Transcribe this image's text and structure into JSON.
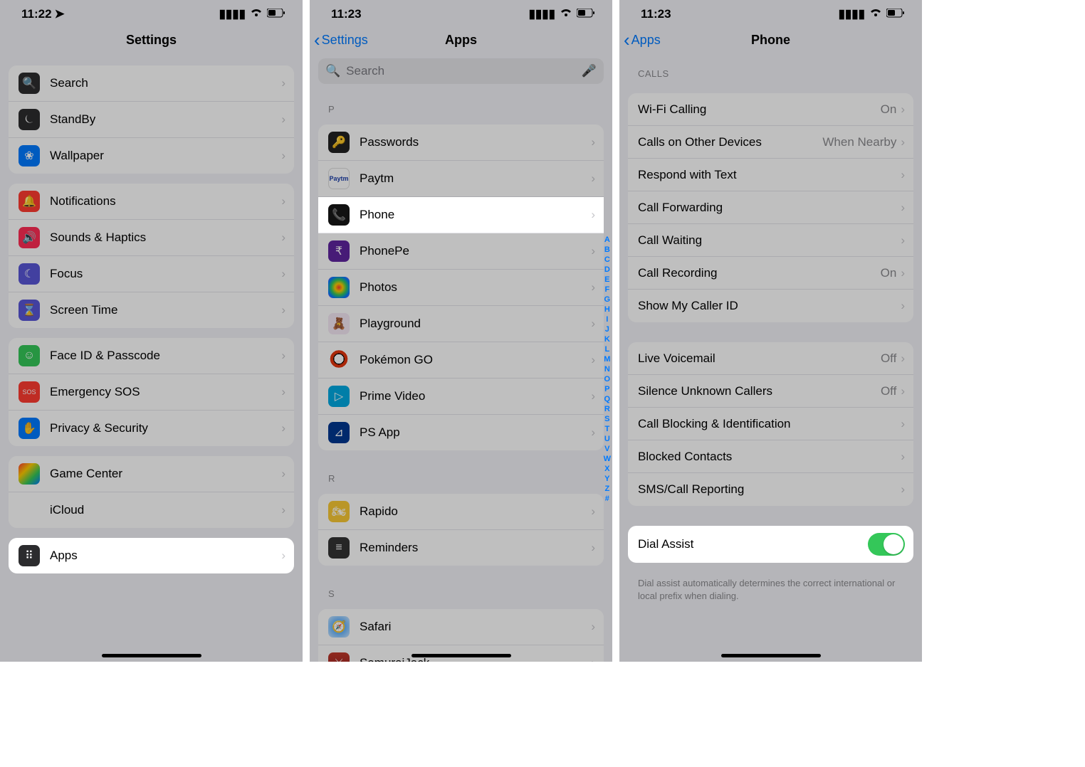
{
  "panel1": {
    "time": "11:22",
    "title": "Settings",
    "groups": [
      [
        {
          "label": "Search",
          "icon": "bg-dark",
          "glyph": "🔍"
        },
        {
          "label": "StandBy",
          "icon": "bg-dark",
          "glyph": "⏾"
        },
        {
          "label": "Wallpaper",
          "icon": "bg-blue",
          "glyph": "❀"
        }
      ],
      [
        {
          "label": "Notifications",
          "icon": "bg-red",
          "glyph": "🔔"
        },
        {
          "label": "Sounds & Haptics",
          "icon": "bg-pink",
          "glyph": "🔊"
        },
        {
          "label": "Focus",
          "icon": "bg-purple",
          "glyph": "☾"
        },
        {
          "label": "Screen Time",
          "icon": "bg-purple",
          "glyph": "⌛"
        }
      ],
      [
        {
          "label": "Face ID & Passcode",
          "icon": "bg-green",
          "glyph": "☺"
        },
        {
          "label": "Emergency SOS",
          "icon": "bg-red",
          "glyph": "SOS"
        },
        {
          "label": "Privacy & Security",
          "icon": "bg-blue",
          "glyph": "✋"
        }
      ],
      [
        {
          "label": "Game Center",
          "icon": "bg-multi",
          "glyph": ""
        },
        {
          "label": "iCloud",
          "icon": "bg-white",
          "glyph": "☁"
        }
      ],
      [
        {
          "label": "Apps",
          "icon": "bg-dark",
          "glyph": "⠿",
          "highlight": true
        }
      ]
    ]
  },
  "panel2": {
    "time": "11:23",
    "back": "Settings",
    "title": "Apps",
    "search_placeholder": "Search",
    "section_p": "P",
    "apps_p": [
      {
        "label": "Passwords",
        "cls": "ai-passwords",
        "glyph": "🔑"
      },
      {
        "label": "Paytm",
        "cls": "ai-paytm",
        "glyph": "Paytm"
      },
      {
        "label": "Phone",
        "cls": "ai-phone",
        "glyph": "📞",
        "highlight": true
      },
      {
        "label": "PhonePe",
        "cls": "ai-phonepe",
        "glyph": "₹"
      },
      {
        "label": "Photos",
        "cls": "ai-photos",
        "glyph": ""
      },
      {
        "label": "Playground",
        "cls": "ai-playground",
        "glyph": "🧸"
      },
      {
        "label": "Pokémon GO",
        "cls": "ai-pokemon",
        "glyph": ""
      },
      {
        "label": "Prime Video",
        "cls": "ai-prime",
        "glyph": "▷"
      },
      {
        "label": "PS App",
        "cls": "ai-ps",
        "glyph": "⊿"
      }
    ],
    "section_r": "R",
    "apps_r": [
      {
        "label": "Rapido",
        "cls": "ai-rapido",
        "glyph": "🏍"
      },
      {
        "label": "Reminders",
        "cls": "ai-reminders",
        "glyph": "≡"
      }
    ],
    "section_s": "S",
    "apps_s": [
      {
        "label": "Safari",
        "cls": "ai-safari",
        "glyph": "🧭"
      },
      {
        "label": "SamuraiJack",
        "cls": "ai-samurai",
        "glyph": "⚔"
      }
    ],
    "index": [
      "A",
      "B",
      "C",
      "D",
      "E",
      "F",
      "G",
      "H",
      "I",
      "J",
      "K",
      "L",
      "M",
      "N",
      "O",
      "P",
      "Q",
      "R",
      "S",
      "T",
      "U",
      "V",
      "W",
      "X",
      "Y",
      "Z",
      "#"
    ]
  },
  "panel3": {
    "time": "11:23",
    "back": "Apps",
    "title": "Phone",
    "section_calls": "CALLS",
    "calls": [
      {
        "label": "Wi-Fi Calling",
        "value": "On"
      },
      {
        "label": "Calls on Other Devices",
        "value": "When Nearby"
      },
      {
        "label": "Respond with Text",
        "value": ""
      },
      {
        "label": "Call Forwarding",
        "value": ""
      },
      {
        "label": "Call Waiting",
        "value": ""
      },
      {
        "label": "Call Recording",
        "value": "On"
      },
      {
        "label": "Show My Caller ID",
        "value": ""
      }
    ],
    "misc": [
      {
        "label": "Live Voicemail",
        "value": "Off"
      },
      {
        "label": "Silence Unknown Callers",
        "value": "Off"
      },
      {
        "label": "Call Blocking & Identification",
        "value": ""
      },
      {
        "label": "Blocked Contacts",
        "value": ""
      },
      {
        "label": "SMS/Call Reporting",
        "value": ""
      }
    ],
    "dial_assist_label": "Dial Assist",
    "dial_assist_footer": "Dial assist automatically determines the correct international or local prefix when dialing."
  }
}
